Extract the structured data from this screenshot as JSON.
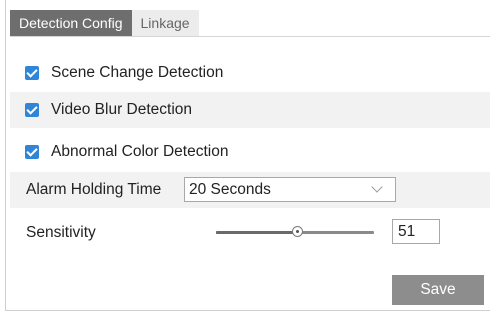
{
  "tabs": [
    {
      "label": "Detection Config",
      "active": true
    },
    {
      "label": "Linkage",
      "active": false
    }
  ],
  "checks": [
    {
      "label": "Scene Change Detection",
      "checked": true
    },
    {
      "label": "Video Blur Detection",
      "checked": true
    },
    {
      "label": "Abnormal Color Detection",
      "checked": true
    }
  ],
  "alarm_holding": {
    "label": "Alarm Holding Time",
    "value": "20 Seconds"
  },
  "sensitivity": {
    "label": "Sensitivity",
    "value": "51",
    "min": 0,
    "max": 100
  },
  "save_label": "Save",
  "colors": {
    "accent": "#2f86d8",
    "tab_active": "#6e6e6e",
    "button": "#8d8d8d"
  }
}
